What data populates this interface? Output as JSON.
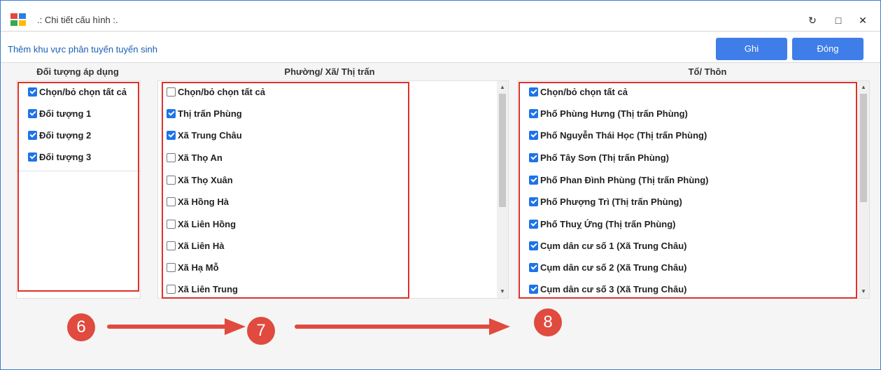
{
  "window": {
    "title": ".: Chi tiết cấu hình :.",
    "refresh_glyph": "↻",
    "maximize_glyph": "□",
    "close_glyph": "✕"
  },
  "toolbar": {
    "title": "Thêm khu vực phân tuyến tuyển sinh",
    "save_label": "Ghi",
    "close_label": "Đóng"
  },
  "columns": {
    "doi_tuong": {
      "header": "Đối tượng áp dụng",
      "items": [
        {
          "label": "Chọn/bỏ chọn tất cả",
          "checked": true
        },
        {
          "label": "Đối tượng 1",
          "checked": true
        },
        {
          "label": "Đối tượng 2",
          "checked": true
        },
        {
          "label": "Đối tượng 3",
          "checked": true
        }
      ]
    },
    "phuong_xa": {
      "header": "Phường/ Xã/ Thị trấn",
      "items": [
        {
          "label": "Chọn/bỏ chọn tất cả",
          "checked": false
        },
        {
          "label": "Thị trấn Phùng",
          "checked": true
        },
        {
          "label": "Xã Trung Châu",
          "checked": true
        },
        {
          "label": "Xã Thọ An",
          "checked": false
        },
        {
          "label": "Xã Thọ Xuân",
          "checked": false
        },
        {
          "label": "Xã Hồng Hà",
          "checked": false
        },
        {
          "label": "Xã Liên Hồng",
          "checked": false
        },
        {
          "label": "Xã Liên Hà",
          "checked": false
        },
        {
          "label": "Xã Hạ Mỗ",
          "checked": false
        },
        {
          "label": "Xã Liên Trung",
          "checked": false
        }
      ]
    },
    "to_thon": {
      "header": "Tổ/ Thôn",
      "items": [
        {
          "label": "Chọn/bỏ chọn tất cả",
          "checked": true
        },
        {
          "label": "Phố Phùng Hưng (Thị trấn Phùng)",
          "checked": true
        },
        {
          "label": "Phố Nguyễn Thái Học (Thị trấn Phùng)",
          "checked": true
        },
        {
          "label": "Phố Tây Sơn (Thị trấn Phùng)",
          "checked": true
        },
        {
          "label": "Phố Phan Đình Phùng (Thị trấn Phùng)",
          "checked": true
        },
        {
          "label": "Phố Phượng Trì (Thị trấn Phùng)",
          "checked": true
        },
        {
          "label": "Phố Thuỵ Ứng (Thị trấn Phùng)",
          "checked": true
        },
        {
          "label": "Cụm dân cư số 1 (Xã Trung Châu)",
          "checked": true
        },
        {
          "label": "Cụm dân cư số 2 (Xã Trung Châu)",
          "checked": true
        },
        {
          "label": "Cụm dân cư số 3 (Xã Trung Châu)",
          "checked": true
        }
      ]
    }
  },
  "annotations": {
    "markers": [
      "6",
      "7",
      "8"
    ],
    "color": "#e04a3f"
  },
  "colors": {
    "accent": "#3f7ee8",
    "title_blue": "#1a5fb4",
    "highlight_red": "#e0302b"
  }
}
